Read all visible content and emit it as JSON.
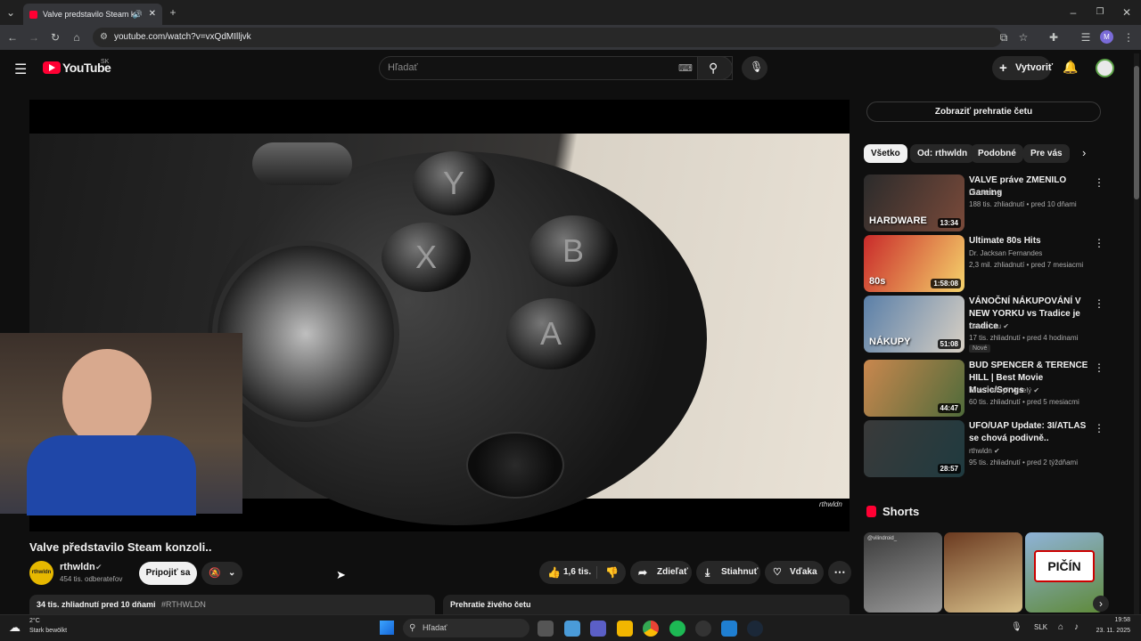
{
  "browser": {
    "tab_title": "Valve predstavilo Steam ko",
    "url": "youtube.com/watch?v=vxQdMIlljvk"
  },
  "header": {
    "logo_text": "YouTube",
    "region": "SK",
    "search_placeholder": "Hľadať",
    "create_label": "Vytvoriť"
  },
  "video": {
    "title": "Valve představilo Steam konzoli..",
    "watermark": "rthwldn",
    "channel_name": "rthwldn",
    "subscribers": "454 tis. odberateľov",
    "join_label": "Pripojiť sa",
    "likes": "1,6 tis.",
    "share_label": "Zdieľať",
    "download_label": "Stiahnuť",
    "thanks_label": "Vďaka",
    "views_line": "34 tis. zhliadnutí  pred 10 dňami",
    "hashtag": "#RTHWLDN",
    "replay_chat_bottom": "Prehratie živého četu"
  },
  "sidebar": {
    "show_chat": "Zobraziť prehratie četu",
    "chips": [
      "Všetko",
      "Od: rthwldn",
      "Podobné",
      "Pre vás"
    ],
    "recs": [
      {
        "title": "VALVE práve ZMENILO Gaming",
        "channel": "Duklock",
        "meta": "188 tis. zhliadnutí • pred 10 dňami",
        "duration": "13:34",
        "thumb_text": "HARDWARE",
        "badge": "",
        "color1": "#2b2b2b",
        "color2": "#7a4a3a"
      },
      {
        "title": "Ultimate 80s Hits",
        "channel": "Dr. Jacksan Fernandes",
        "meta": "2,3 mil. zhliadnutí • pred 7 mesiacmi",
        "duration": "1:58:08",
        "thumb_text": "80s",
        "badge": "",
        "color1": "#c92a2a",
        "color2": "#f5d36b"
      },
      {
        "title": "VÁNOČNÍ NÁKUPOVÁNÍ V NEW YORKU vs Tradice je tradice",
        "channel": "David Luu",
        "meta": "17 tis. zhliadnutí • pred 4 hodinami",
        "duration": "51:08",
        "thumb_text": "NÁKUPY",
        "badge": "Nové",
        "color1": "#5a7fa8",
        "color2": "#d8d0c4"
      },
      {
        "title": "BUD SPENCER & TERENCE HILL | Best Movie Music/Songs",
        "channel": "Tom \"Henry\" Veselý",
        "meta": "60 tis. zhliadnutí • pred 5 mesiacmi",
        "duration": "44:47",
        "thumb_text": "",
        "badge": "",
        "color1": "#c9874e",
        "color2": "#4f6b3a"
      },
      {
        "title": "UFO/UAP Update: 3I/ATLAS se chová podivně..",
        "channel": "rthwldn",
        "meta": "95 tis. zhliadnutí • pred 2 týždňami",
        "duration": "28:57",
        "thumb_text": "",
        "badge": "",
        "color1": "#3a3a3a",
        "color2": "#1f3a3f"
      }
    ],
    "shorts_label": "Shorts",
    "shorts": [
      {
        "text": "@vilindroid_",
        "color1": "#3b3b3b",
        "color2": "#9a9a9a"
      },
      {
        "text": "",
        "color1": "#6b3a20",
        "color2": "#d8c08a"
      },
      {
        "text": "PIČÍN",
        "color1": "#8fb3d8",
        "color2": "#5f8a3a"
      }
    ]
  },
  "taskbar": {
    "temp": "2°C",
    "weather": "Stark bewölkt",
    "search": "Hľadať",
    "lang": "SLK",
    "time": "19:58",
    "date": "23. 11. 2025"
  }
}
